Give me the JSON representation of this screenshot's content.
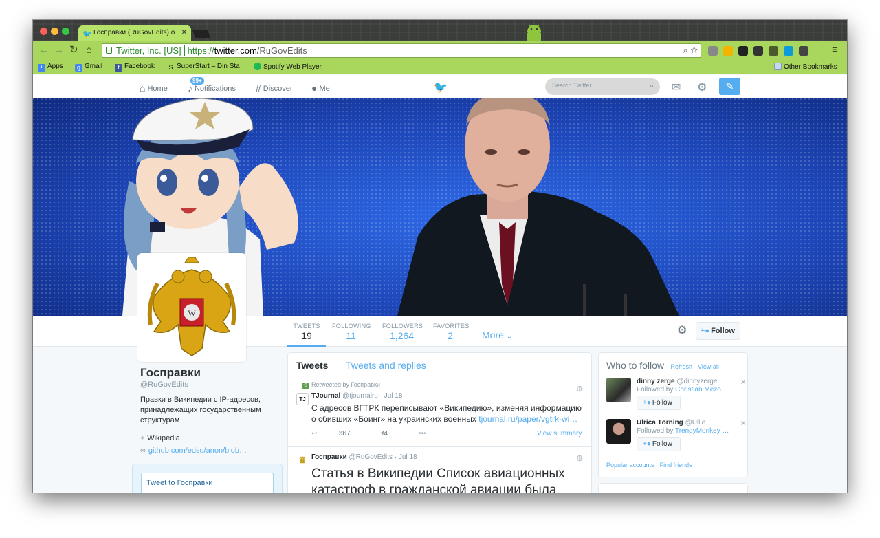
{
  "browser": {
    "tab_title": "Госправки (RuGovEdits) o",
    "ev_label": "Twitter, Inc. [US]",
    "url_scheme": "https://",
    "url_host": "twitter.com",
    "url_path": "/RuGovEdits",
    "bookmarks": [
      {
        "label": "Apps",
        "icon": "apps-grid-icon",
        "color": "#4285f4"
      },
      {
        "label": "Gmail",
        "icon": "google-g-icon",
        "color": "#4285f4"
      },
      {
        "label": "Facebook",
        "icon": "facebook-icon",
        "color": "#3b5998"
      },
      {
        "label": "SuperStart – Din Sta",
        "icon": "superstart-icon",
        "color": "#222222"
      },
      {
        "label": "Spotify Web Player",
        "icon": "spotify-icon",
        "color": "#1db954"
      }
    ],
    "other_bookmarks": "Other Bookmarks"
  },
  "twitter_nav": {
    "home": "Home",
    "notifications": "Notifications",
    "notifications_badge": "99+",
    "discover": "Discover",
    "me": "Me",
    "search_placeholder": "Search Twitter"
  },
  "profile": {
    "name": "Госправки",
    "handle": "@RuGovEdits",
    "bio": "Правки в Википедии с IP-адресов, принадлежащих государственным структурам",
    "location": "Wikipedia",
    "website": "github.com/edsu/anon/blob…",
    "stats": [
      {
        "label": "TWEETS",
        "value": "19"
      },
      {
        "label": "FOLLOWING",
        "value": "11"
      },
      {
        "label": "FOLLOWERS",
        "value": "1,264"
      },
      {
        "label": "FAVORITES",
        "value": "2"
      }
    ],
    "more_label": "More",
    "follow_label": "Follow",
    "tweet_to": "Tweet to Госправки"
  },
  "timeline": {
    "tab_tweets": "Tweets",
    "tab_replies": "Tweets and replies",
    "tweets": [
      {
        "retweeted_by": "Retweeted by Госправки",
        "author": "TJournal",
        "handle": "@tjournalru",
        "date": "· Jul 18",
        "avatar_text": "TJ",
        "text": "С адресов ВГТРК переписывают «Википедию», изменяя информацию о сбивших «Боинг» на украинских военных",
        "link": "tjournal.ru/paper/vgtrk-wi…",
        "retweets": "367",
        "favorites": "74",
        "view_summary": "View summary"
      },
      {
        "author": "Госправки",
        "handle": "@RuGovEdits",
        "date": "· Jul 18",
        "text": "Статья в Википедии Список авиационных катастроф в гражданской авиации была"
      }
    ]
  },
  "who_to_follow": {
    "title": "Who to follow",
    "refresh": "Refresh",
    "view_all": "View all",
    "suggestions": [
      {
        "name": "dinny zerge",
        "handle": "@dinnyzerge",
        "followed_by_prefix": "Followed by",
        "followed_by": "Christian Mezö…",
        "follow_label": "Follow"
      },
      {
        "name": "Ulrica Törning",
        "handle": "@Ullie",
        "followed_by_prefix": "Followed by",
        "followed_by": "TrendyMonkey …",
        "follow_label": "Follow"
      }
    ],
    "popular_accounts": "Popular accounts",
    "find_friends": "Find friends"
  },
  "colors": {
    "twitter_blue": "#55acee",
    "chrome_green": "#a9d65d",
    "header_blue": "#1f4fc4"
  }
}
